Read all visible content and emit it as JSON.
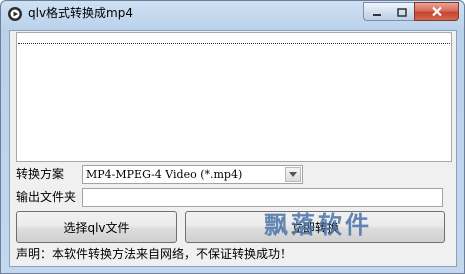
{
  "window": {
    "title": "qlv格式转换成mp4",
    "icon": "app-logo-icon"
  },
  "controls": {
    "minimize_icon": "minimize-icon",
    "maximize_icon": "maximize-icon",
    "close_icon": "close-icon"
  },
  "form": {
    "scheme_label": "转换方案",
    "scheme_value": "MP4-MPEG-4 Video (*.mp4)",
    "output_label": "输出文件夹",
    "output_value": ""
  },
  "buttons": {
    "select_label": "选择qlv文件",
    "convert_label": "立即转换"
  },
  "watermark": "飘落软件",
  "notice": "声明：本软件转换方法来自网络，不保证转换成功！",
  "colors": {
    "close_red": "#c44632",
    "title_gradient": "#b9d1ea",
    "watermark_blue": "#4a73a8"
  }
}
